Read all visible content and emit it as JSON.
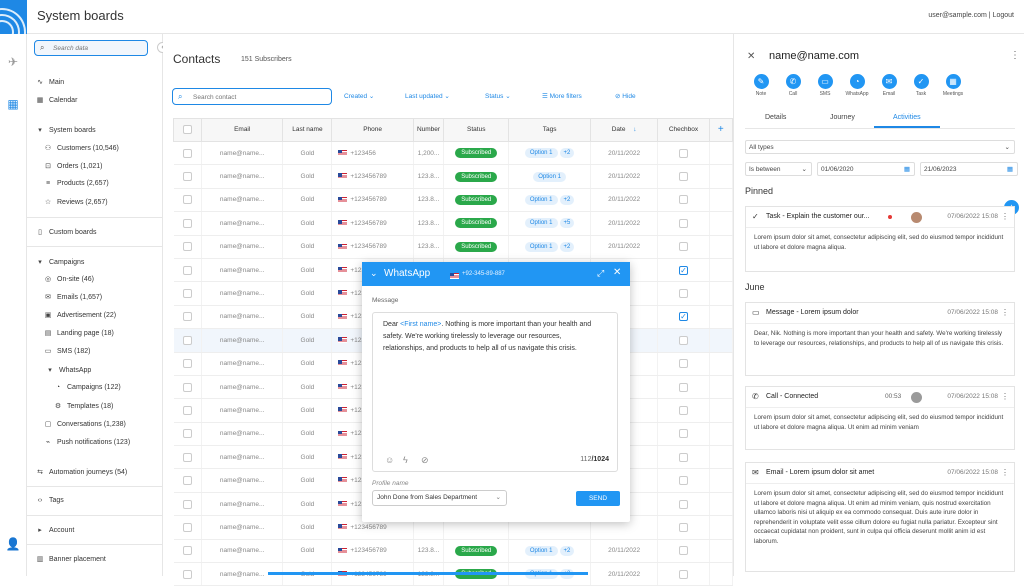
{
  "app": {
    "title": "System boards",
    "user_email": "user@sample.com",
    "logout": "Logout",
    "separator": "|"
  },
  "sidebar": {
    "search_placeholder": "Search data",
    "items": [
      {
        "label": "Main",
        "icon": "pulse-icon"
      },
      {
        "label": "Calendar",
        "icon": "calendar-icon"
      },
      {
        "label": "System boards",
        "icon": "caret-down-icon"
      },
      {
        "label": "Customers (10,546)",
        "icon": "users-icon"
      },
      {
        "label": "Orders (1,021)",
        "icon": "cart-icon"
      },
      {
        "label": "Products (2,657)",
        "icon": "list-icon"
      },
      {
        "label": "Reviews (2,657)",
        "icon": "star-icon"
      },
      {
        "label": "Custom boards",
        "icon": "board-icon"
      },
      {
        "label": "Campaigns",
        "icon": "caret-down-icon"
      },
      {
        "label": "On-site (46)",
        "icon": "target-icon"
      },
      {
        "label": "Emails (1,657)",
        "icon": "mail-icon"
      },
      {
        "label": "Advertisement (22)",
        "icon": "ad-icon"
      },
      {
        "label": "Landing page (18)",
        "icon": "page-icon"
      },
      {
        "label": "SMS (182)",
        "icon": "sms-icon"
      },
      {
        "label": "WhatsApp",
        "icon": "caret-down-icon"
      },
      {
        "label": "Campaigns (122)",
        "icon": "whatsapp-icon"
      },
      {
        "label": "Templates (18)",
        "icon": "template-icon"
      },
      {
        "label": "Conversations (1,238)",
        "icon": "chat-icon"
      },
      {
        "label": "Push notifications (123)",
        "icon": "push-icon"
      },
      {
        "label": "Automation journeys (54)",
        "icon": "automation-icon"
      },
      {
        "label": "Tags",
        "icon": "tag-icon"
      },
      {
        "label": "Account",
        "icon": "caret-right-icon"
      },
      {
        "label": "Banner placement",
        "icon": "book-icon"
      }
    ]
  },
  "contacts": {
    "title": "Contacts",
    "subscribers": "151 Subscribers",
    "search_placeholder": "Search contact",
    "filters": [
      "Created",
      "Last updated",
      "Status",
      "More filters",
      "Hide"
    ],
    "columns": [
      "Email",
      "Last name",
      "Number",
      "Phone",
      "Status",
      "Tags",
      "Date",
      "Chechbox"
    ],
    "rows": [
      {
        "email": "name@name...",
        "last": "Gold",
        "phone": "+123456",
        "number": "1,200...",
        "status": "Subscribed",
        "tag": "Option 1",
        "tagn": "+2",
        "date": "20/11/2022",
        "checked": false
      },
      {
        "email": "name@name...",
        "last": "Gold",
        "phone": "+123456789",
        "number": "123.8...",
        "status": "Subscribed",
        "tag": "Option 1",
        "tagn": "",
        "date": "20/11/2022",
        "checked": false
      },
      {
        "email": "name@name...",
        "last": "Gold",
        "phone": "+123456789",
        "number": "123.8...",
        "status": "Subscribed",
        "tag": "Option 1",
        "tagn": "+2",
        "date": "20/11/2022",
        "checked": false
      },
      {
        "email": "name@name...",
        "last": "Gold",
        "phone": "+123456789",
        "number": "123.8...",
        "status": "Subscribed",
        "tag": "Option 1",
        "tagn": "+5",
        "date": "20/11/2022",
        "checked": false
      },
      {
        "email": "name@name...",
        "last": "Gold",
        "phone": "+123456789",
        "number": "123.8...",
        "status": "Subscribed",
        "tag": "Option 1",
        "tagn": "+2",
        "date": "20/11/2022",
        "checked": false
      },
      {
        "email": "name@name...",
        "last": "Gold",
        "phone": "+123456789",
        "number": "",
        "status": "",
        "tag": "",
        "tagn": "",
        "date": "",
        "checked": true
      },
      {
        "email": "name@name...",
        "last": "Gold",
        "phone": "+123456789",
        "number": "",
        "status": "",
        "tag": "",
        "tagn": "",
        "date": "",
        "checked": false
      },
      {
        "email": "name@name...",
        "last": "Gold",
        "phone": "+123456789",
        "number": "",
        "status": "",
        "tag": "",
        "tagn": "",
        "date": "",
        "checked": true
      },
      {
        "email": "name@name...",
        "last": "Gold",
        "phone": "+123456789",
        "number": "",
        "status": "",
        "tag": "",
        "tagn": "",
        "date": "",
        "checked": false
      },
      {
        "email": "name@name...",
        "last": "Gold",
        "phone": "+123456789",
        "number": "",
        "status": "",
        "tag": "",
        "tagn": "",
        "date": "",
        "checked": false
      },
      {
        "email": "name@name...",
        "last": "Gold",
        "phone": "+123456789",
        "number": "",
        "status": "",
        "tag": "",
        "tagn": "",
        "date": "",
        "checked": false
      },
      {
        "email": "name@name...",
        "last": "Gold",
        "phone": "+123456789",
        "number": "",
        "status": "",
        "tag": "",
        "tagn": "",
        "date": "",
        "checked": false
      },
      {
        "email": "name@name...",
        "last": "Gold",
        "phone": "+123456789",
        "number": "",
        "status": "",
        "tag": "",
        "tagn": "",
        "date": "",
        "checked": false
      },
      {
        "email": "name@name...",
        "last": "Gold",
        "phone": "+123456789",
        "number": "",
        "status": "",
        "tag": "",
        "tagn": "",
        "date": "",
        "checked": false
      },
      {
        "email": "name@name...",
        "last": "Gold",
        "phone": "+123456789",
        "number": "",
        "status": "",
        "tag": "",
        "tagn": "",
        "date": "",
        "checked": false
      },
      {
        "email": "name@name...",
        "last": "Gold",
        "phone": "+123456789",
        "number": "",
        "status": "",
        "tag": "",
        "tagn": "",
        "date": "",
        "checked": false
      },
      {
        "email": "name@name...",
        "last": "Gold",
        "phone": "+123456789",
        "number": "",
        "status": "",
        "tag": "",
        "tagn": "",
        "date": "",
        "checked": false
      },
      {
        "email": "name@name...",
        "last": "Gold",
        "phone": "+123456789",
        "number": "123.8...",
        "status": "Subscribed",
        "tag": "Option 1",
        "tagn": "+2",
        "date": "20/11/2022",
        "checked": false
      },
      {
        "email": "name@name...",
        "last": "Gold",
        "phone": "+123456789",
        "number": "123.8...",
        "status": "Subscribed",
        "tag": "Option 1",
        "tagn": "+2",
        "date": "20/11/2022",
        "checked": false
      }
    ]
  },
  "whatsapp": {
    "title": "WhatsApp",
    "phone": "+92-345-89-887",
    "message_label": "Message",
    "message_prefix": "Dear ",
    "message_var": "<First name>",
    "message_body": ". Nothing is more important than your health and safety. We're working tirelessly to leverage our resources, relationships, and products to help all of us navigate this crisis.",
    "count_used": "112",
    "count_max": "/1024",
    "profile_label": "Profile name",
    "profile_value": "John Done from Sales Department",
    "send": "SEND"
  },
  "panel": {
    "name": "name@name.com",
    "actions": [
      "Note",
      "Call",
      "SMS",
      "WhatsApp",
      "Email",
      "Task",
      "Meetings"
    ],
    "tabs": [
      "Details",
      "Journey",
      "Activities"
    ],
    "active_tab": "Activities",
    "type_filter": "All types",
    "date_op": "Is between",
    "date_from": "01/06/2020",
    "date_to": "21/06/2023",
    "pinned_label": "Pinned",
    "june_label": "June",
    "cards": [
      {
        "title": "Task - Explain the customer our...",
        "date": "07/06/2022 15:08",
        "body": "Lorem ipsum dolor sit amet, consectetur adipiscing elit, sed do eiusmod tempor incididunt ut labore et dolore magna aliqua."
      },
      {
        "title": "Message - Lorem ipsum dolor",
        "date": "07/06/2022 15:08",
        "body": "Dear, Nik. Nothing is more important than your health and safety. We're working tirelessly to leverage our resources, relationships, and products to help all of us navigate this crisis."
      },
      {
        "title": "Call - Connected",
        "duration": "00:53",
        "date": "07/06/2022 15:08",
        "body": "Lorem ipsum dolor sit amet, consectetur adipiscing elit, sed do eiusmod tempor incididunt ut labore et dolore magna aliqua. Ut enim ad minim veniam"
      },
      {
        "title": "Email - Lorem ipsum dolor sit amet",
        "date": "07/06/2022 15:08",
        "body": "Lorem ipsum dolor sit amet, consectetur adipiscing elit, sed do eiusmod tempor incididunt ut labore et dolore magna aliqua. Ut enim ad minim veniam, quis nostrud exercitation ullamco laboris nisi ut aliquip ex ea commodo consequat. Duis aute irure dolor in reprehenderit in voluptate velit esse cillum dolore eu fugiat nulla pariatur. Excepteur sint occaecat cupidatat non proident, sunt in culpa qui officia deserunt mollit anim id est laborum."
      }
    ]
  },
  "colors": {
    "accent": "#2196f3",
    "subscribed": "#2aa84a",
    "border": "#e6e6e6"
  }
}
